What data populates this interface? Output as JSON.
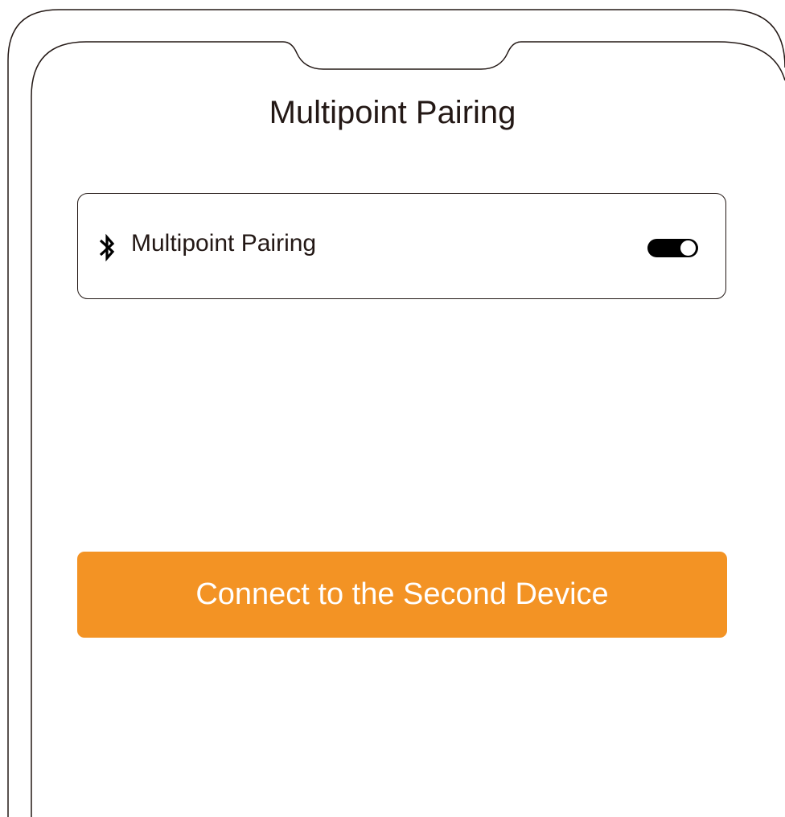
{
  "screen": {
    "title": "Multipoint Pairing"
  },
  "setting": {
    "icon": "bluetooth-icon",
    "label": "Multipoint Pairing",
    "toggle_state": "on"
  },
  "action": {
    "button_label": "Connect to the Second Device"
  },
  "colors": {
    "accent": "#f39324",
    "text": "#231815",
    "toggle_track": "#000000",
    "background": "#ffffff"
  }
}
